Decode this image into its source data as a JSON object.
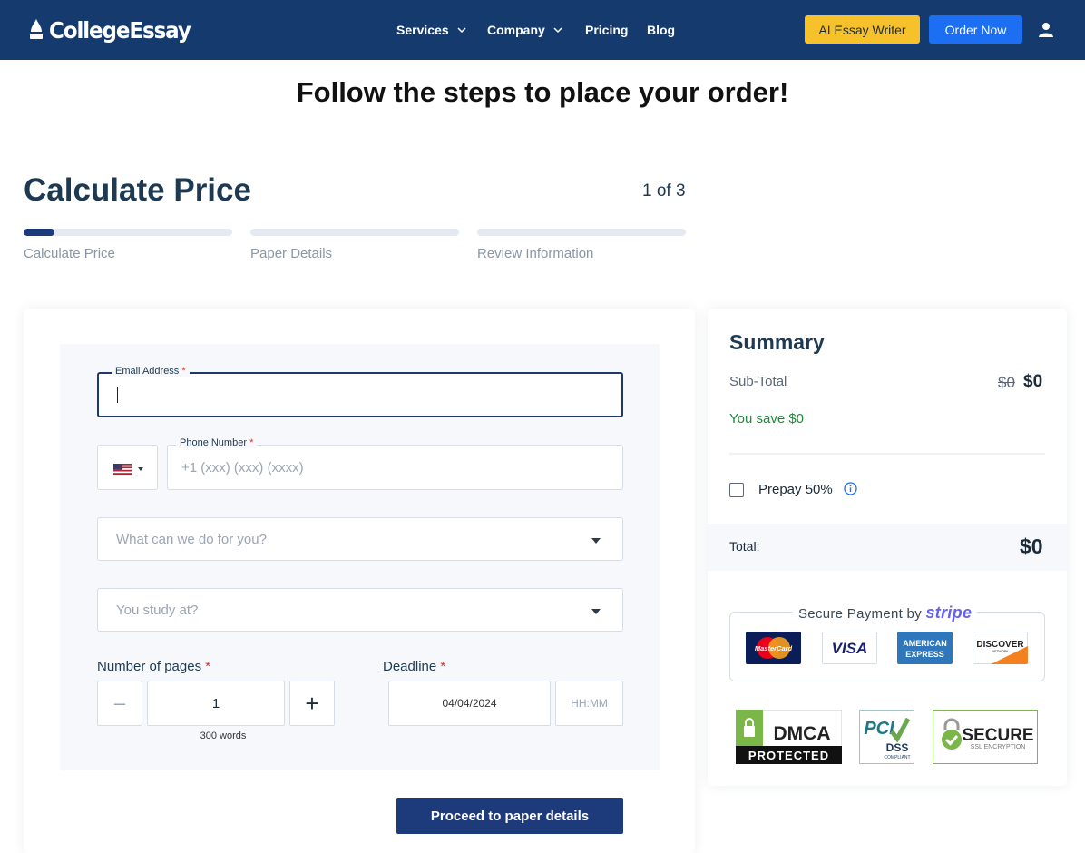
{
  "header": {
    "logo_text": "CollegeEssay",
    "nav": [
      {
        "label": "Services",
        "dropdown": true
      },
      {
        "label": "Company",
        "dropdown": true
      },
      {
        "label": "Pricing",
        "dropdown": false
      },
      {
        "label": "Blog",
        "dropdown": false
      }
    ],
    "ai_button": "AI Essay Writer",
    "order_button": "Order Now",
    "user_icon": "user-icon"
  },
  "page": {
    "title": "Follow the steps to place your order!",
    "section_title": "Calculate Price",
    "step_counter": "1 of 3",
    "steps": [
      {
        "label": "Calculate Price",
        "progress": 0.15
      },
      {
        "label": "Paper Details",
        "progress": 0
      },
      {
        "label": "Review Information",
        "progress": 0
      }
    ]
  },
  "form": {
    "email": {
      "label": "Email Address",
      "required": "*",
      "value": ""
    },
    "phone": {
      "label": "Phone Number",
      "required": "*",
      "placeholder": "+1 (xxx) (xxx) (xxxx)",
      "country": "US"
    },
    "service_select": {
      "placeholder": "What can we do for you?"
    },
    "study_select": {
      "placeholder": "You study at?"
    },
    "pages": {
      "label": "Number of pages",
      "required": "*",
      "value": "1",
      "minus": "–",
      "plus": "+",
      "words": "300 words"
    },
    "deadline": {
      "label": "Deadline",
      "required": "*",
      "date": "04/04/2024",
      "time_placeholder": "HH:MM"
    },
    "proceed_button": "Proceed to paper details"
  },
  "summary": {
    "title": "Summary",
    "subtotal_label": "Sub-Total",
    "subtotal_old": "$0",
    "subtotal_new": "$0",
    "savings": "You save $0",
    "prepay_label": "Prepay 50%",
    "prepay_checked": false,
    "total_label": "Total:",
    "total_value": "$0",
    "secure_payment_prefix": "Secure Payment by",
    "secure_payment_brand": "stripe",
    "cards": [
      "MasterCard",
      "VISA",
      "AMERICAN EXPRESS",
      "DISCOVER"
    ],
    "badges": {
      "dmca": {
        "top": "DMCA",
        "bottom": "PROTECTED"
      },
      "pci": {
        "top": "PCI",
        "bottom": "DSS",
        "sub": "COMPLIANT"
      },
      "secure": {
        "top": "SECURE",
        "bottom": "SSL ENCRYPTION"
      }
    }
  },
  "colors": {
    "header_bg": "#143a6e",
    "ai_button": "#f6c12b",
    "order_button": "#1c6ef2",
    "primary": "#1d3a7a",
    "savings_green": "#1e8a3a"
  }
}
